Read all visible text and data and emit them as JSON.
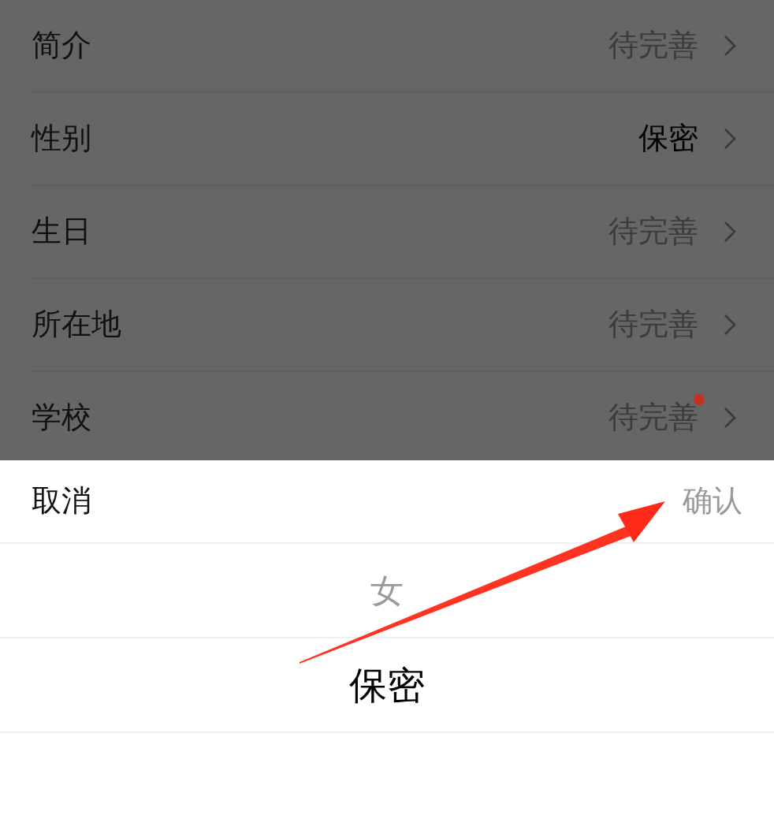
{
  "profile_rows": [
    {
      "label": "简介",
      "value": "待完善",
      "filled": false,
      "badge": false
    },
    {
      "label": "性别",
      "value": "保密",
      "filled": true,
      "badge": false
    },
    {
      "label": "生日",
      "value": "待完善",
      "filled": false,
      "badge": false
    },
    {
      "label": "所在地",
      "value": "待完善",
      "filled": false,
      "badge": false
    },
    {
      "label": "学校",
      "value": "待完善",
      "filled": false,
      "badge": true
    }
  ],
  "picker": {
    "cancel": "取消",
    "confirm": "确认",
    "options": [
      {
        "label": "女",
        "selected": false
      },
      {
        "label": "保密",
        "selected": true
      }
    ]
  },
  "annotation": {
    "kind": "arrow"
  }
}
